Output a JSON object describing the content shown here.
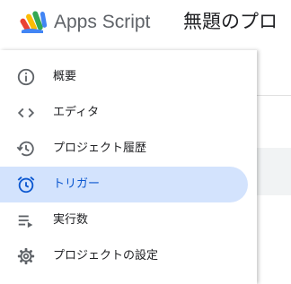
{
  "header": {
    "app_name": "Apps Script",
    "project_title": "無題のプロ"
  },
  "nav": {
    "items": [
      {
        "label": "概要",
        "icon": "info-icon",
        "active": false
      },
      {
        "label": "エディタ",
        "icon": "code-icon",
        "active": false
      },
      {
        "label": "プロジェクト履歴",
        "icon": "history-icon",
        "active": false
      },
      {
        "label": "トリガー",
        "icon": "alarm-clock-icon",
        "active": true
      },
      {
        "label": "実行数",
        "icon": "executions-icon",
        "active": false
      },
      {
        "label": "プロジェクトの設定",
        "icon": "gear-icon",
        "active": false
      }
    ]
  },
  "colors": {
    "active_bg": "#d3e3fd",
    "active_fg": "#0b57d0",
    "icon": "#5f6368",
    "text": "#202124"
  }
}
